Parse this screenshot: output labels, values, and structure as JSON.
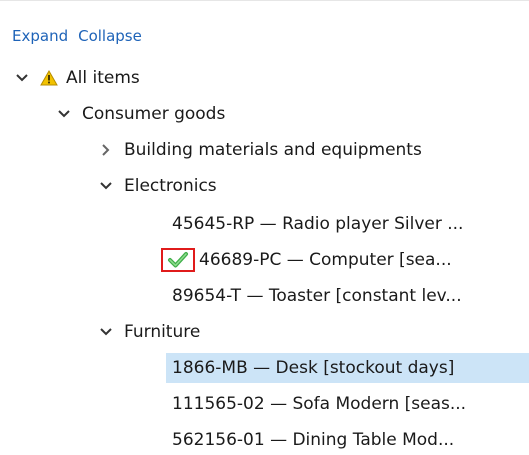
{
  "toolbar": {
    "expand_label": "Expand",
    "collapse_label": "Collapse"
  },
  "tree": {
    "root": {
      "label": "All items",
      "icon": "warning-icon"
    },
    "consumer_goods": {
      "label": "Consumer goods"
    },
    "building": {
      "label": "Building materials and equipments"
    },
    "electronics": {
      "label": "Electronics",
      "items": [
        "45645-RP — Radio player Silver ...",
        "46689-PC — Computer  [sea...",
        "89654-T — Toaster [constant lev..."
      ]
    },
    "furniture": {
      "label": "Furniture",
      "items": [
        "1866-MB — Desk [stockout days]",
        "111565-02 — Sofa Modern [seas...",
        "562156-01 — Dining Table Mod..."
      ]
    }
  },
  "colors": {
    "link": "#1e63b8",
    "selection": "#cce4f7",
    "check_highlight": "#e01b1b",
    "check": "#3fae49",
    "warning": "#f2c200"
  }
}
